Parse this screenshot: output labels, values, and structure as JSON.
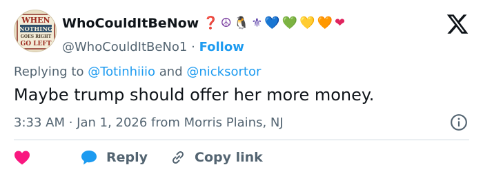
{
  "user": {
    "display_name": "WhoCouldItBeNow",
    "handle": "@WhoCouldItBeNo1",
    "separator": "·",
    "follow_label": "Follow",
    "avatar_text": [
      "WHEN",
      "NOTHING",
      "GOES RIGHT",
      "GO LEFT"
    ],
    "emojis": [
      "❓",
      "☮",
      "🐧",
      "⚜",
      "💙",
      "💚",
      "💛",
      "🧡",
      "❤"
    ]
  },
  "reply_context": {
    "prefix": "Replying to ",
    "mention1": "@Totinhiiio",
    "joiner": " and ",
    "mention2": "@nicksortor"
  },
  "tweet": {
    "text": "Maybe trump should offer her more money.",
    "timestamp": "3:33 AM · Jan 1, 2026 from Morris Plains, NJ"
  },
  "actions": {
    "reply_label": "Reply",
    "copy_link_label": "Copy link"
  },
  "colors": {
    "accent": "#1d9bf0",
    "like": "#f91880",
    "muted": "#536471",
    "text": "#0f1419"
  },
  "icons": [
    "x-logo-icon",
    "info-icon",
    "heart-icon",
    "reply-bubble-icon",
    "link-icon"
  ]
}
